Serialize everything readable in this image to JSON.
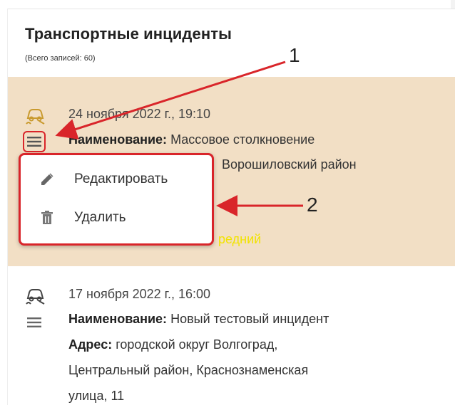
{
  "header": {
    "title": "Транспортные инциденты",
    "subtitle": "(Всего записей: 60)"
  },
  "incidents": [
    {
      "timestamp": "24 ноября 2022 г., 19:10",
      "name_label": "Наименование:",
      "name_value": "Массовое столкновение",
      "address_fragment": "Ворошиловский район",
      "priority_fragment": "редний"
    },
    {
      "timestamp": "17 ноября 2022 г., 16:00",
      "name_label": "Наименование:",
      "name_value": "Новый тестовый инцидент",
      "address_label": "Адрес:",
      "address_line1": "городской округ Волгоград,",
      "address_line2": "Центральный район, Краснознаменская",
      "address_line3": "улица, 11"
    }
  ],
  "context_menu": {
    "items": [
      {
        "label": "Редактировать",
        "icon": "pencil-icon"
      },
      {
        "label": "Удалить",
        "icon": "trash-icon"
      }
    ]
  },
  "annotations": {
    "callout_1": "1",
    "callout_2": "2"
  },
  "colors": {
    "selected_row_bg": "#f2dfc5",
    "highlight_red": "#d9252a",
    "priority_yellow": "#f2e300",
    "incident_icon_selected": "#c99a2e",
    "incident_icon_normal": "#444444"
  }
}
